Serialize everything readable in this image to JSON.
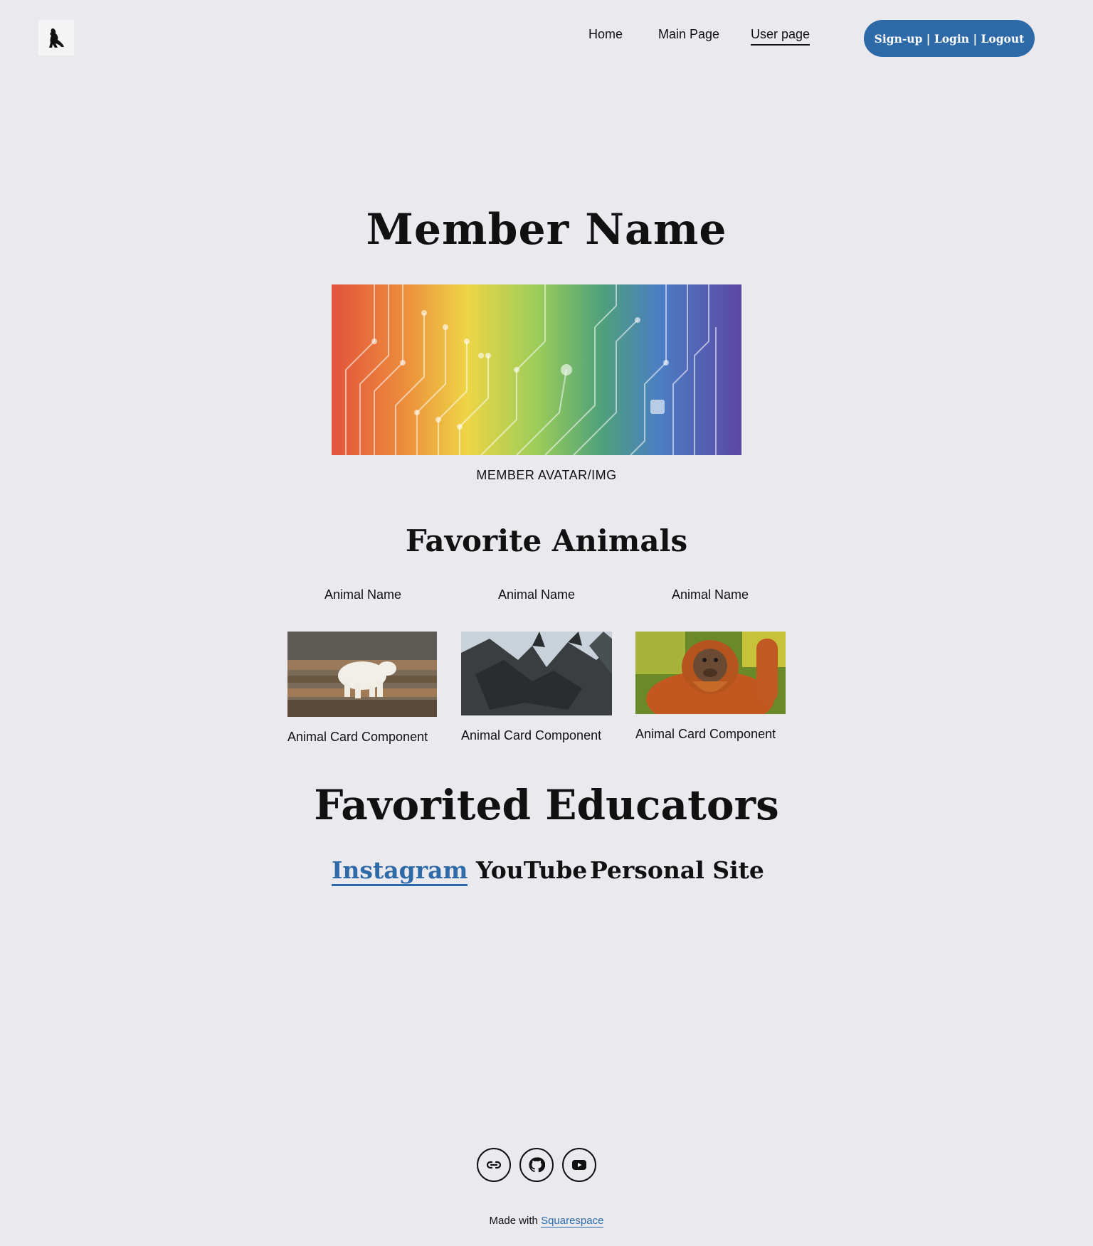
{
  "header": {
    "logo_icon": "lion-logo-icon",
    "nav": [
      {
        "label": "Home",
        "active": false
      },
      {
        "label": "Main Page",
        "active": false
      },
      {
        "label": "User page",
        "active": true
      }
    ],
    "cta_label": "Sign-up | Login | Logout",
    "accent_color": "#2f6aa8"
  },
  "member": {
    "name": "Member Name",
    "avatar_caption": "MEMBER AVATAR/IMG"
  },
  "favorite_animals": {
    "title": "Favorite Animals",
    "cards": [
      {
        "name": "Animal Name",
        "caption": "Animal Card Component",
        "image": "polar-bear"
      },
      {
        "name": "Animal Name",
        "caption": "Animal Card Component",
        "image": "dragon"
      },
      {
        "name": "Animal Name",
        "caption": "Animal Card Component",
        "image": "orangutan"
      }
    ]
  },
  "favorited_educators": {
    "title": "Favorited Educators",
    "links": [
      {
        "label": "Instagram",
        "active": true
      },
      {
        "label": "YouTube",
        "active": false
      },
      {
        "label": "Personal Site",
        "active": false
      }
    ]
  },
  "footer": {
    "social_icons": [
      "link-icon",
      "github-icon",
      "youtube-icon"
    ],
    "made_with_prefix": "Made with",
    "made_with_link": "Squarespace"
  }
}
